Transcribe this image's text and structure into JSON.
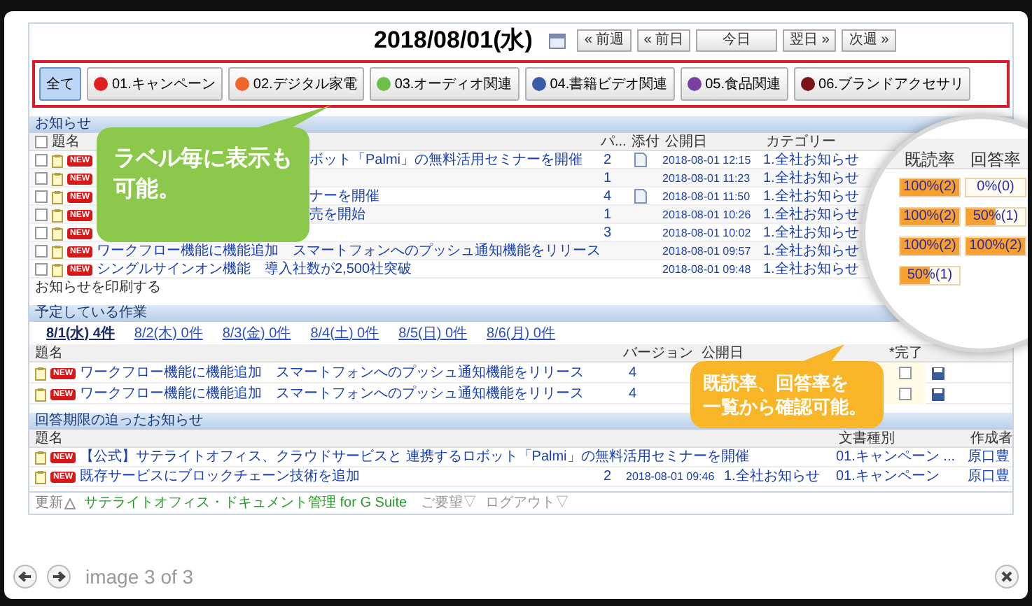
{
  "header": {
    "date": "2018/08/01(水)",
    "nav_buttons": [
      "« 前週",
      "« 前日",
      "今日",
      "翌日 »",
      "次週 »"
    ]
  },
  "labels": [
    {
      "label": "全て",
      "selected": true
    },
    {
      "label": "01.キャンペーン",
      "color": "#e02020",
      "selected": false
    },
    {
      "label": "02.デジタル家電",
      "color": "#f0642c",
      "selected": false
    },
    {
      "label": "03.オーディオ関連",
      "color": "#6cc04a",
      "selected": false
    },
    {
      "label": "04.書籍ビデオ関連",
      "color": "#3a5ba8",
      "selected": false
    },
    {
      "label": "05.食品関連",
      "color": "#7a3fa0",
      "selected": false
    },
    {
      "label": "06.ブランドアクセサリ",
      "color": "#7a1418",
      "selected": false
    }
  ],
  "notices": {
    "title": "お知らせ",
    "select_all_checked": false,
    "columns": [
      "題名",
      "パ...",
      "添付",
      "公開日",
      "カテゴリー"
    ],
    "rows": [
      {
        "kind": "covered",
        "checked": false,
        "badge": "NEW",
        "title": "ボット「Palmi」の無料活用セミナーを開催",
        "version": "2",
        "attachment": true,
        "date": "2018-08-01 12:15",
        "category": "1.全社お知らせ"
      },
      {
        "kind": "covered",
        "checked": false,
        "badge": "NEW",
        "version": "1",
        "attachment": false,
        "date": "2018-08-01 11:23",
        "category": "1.全社お知らせ"
      },
      {
        "kind": "covered",
        "checked": false,
        "badge": "NEW",
        "title": "ナーを開催",
        "version": "4",
        "attachment": true,
        "date": "2018-08-01 11:50",
        "category": "1.全社お知らせ"
      },
      {
        "kind": "covered",
        "checked": false,
        "badge": "NEW",
        "title": "売を開始",
        "version": "1",
        "attachment": false,
        "date": "2018-08-01 10:26",
        "category": "1.全社お知らせ"
      },
      {
        "kind": "covered",
        "checked": false,
        "badge": "NEW",
        "version": "3",
        "attachment": false,
        "date": "2018-08-01 10:02",
        "category": "1.全社お知らせ"
      },
      {
        "kind": "full",
        "checked": false,
        "badge": "NEW",
        "title": "ワークフロー機能に機能追加　スマートフォンへのプッシュ通知機能をリリース",
        "attachment": false,
        "date": "2018-08-01 09:57",
        "category": "1.全社お知らせ"
      },
      {
        "kind": "full",
        "checked": false,
        "badge": "NEW",
        "title": "シングルサインオン機能　導入社数が2,500社突破",
        "attachment": false,
        "date": "2018-08-01 09:48",
        "category": "1.全社お知らせ"
      }
    ],
    "print_link": "お知らせを印刷する"
  },
  "rates": {
    "columns": [
      "既読率",
      "回答率"
    ],
    "rows": [
      {
        "read": {
          "text": "100%(2)",
          "level": 1
        },
        "answer": {
          "text": "0%(0)",
          "level": 0
        }
      },
      {
        "read": {
          "text": "100%(2)",
          "level": 1
        },
        "answer": {
          "text": "50%(1)",
          "level": 0.5
        }
      },
      {
        "read": {
          "text": "100%(2)",
          "level": 1
        },
        "answer": {
          "text": "100%(2)",
          "level": 1
        }
      },
      {
        "read": {
          "text": "50%(1)",
          "level": 0.5
        }
      }
    ]
  },
  "scheduled": {
    "title": "予定している作業",
    "days": [
      {
        "label": "8/1(水) 4件",
        "selected": true
      },
      {
        "label": "8/2(木) 0件",
        "selected": false
      },
      {
        "label": "8/3(金) 0件",
        "selected": false
      },
      {
        "label": "8/4(土) 0件",
        "selected": false
      },
      {
        "label": "8/5(日) 0件",
        "selected": false
      },
      {
        "label": "8/6(月) 0件",
        "selected": false
      }
    ],
    "columns": [
      "題名",
      "バージョン",
      "公開日",
      "*完了"
    ],
    "rows": [
      {
        "badge": "NEW",
        "title": "ワークフロー機能に機能追加　スマートフォンへのプッシュ通知機能をリリース",
        "version": "4",
        "done": false
      },
      {
        "badge": "NEW",
        "title": "ワークフロー機能に機能追加　スマートフォンへのプッシュ通知機能をリリース",
        "version": "4",
        "done": false
      }
    ]
  },
  "deadline": {
    "title": "回答期限の迫ったお知らせ",
    "columns": [
      "題名",
      "文書種別",
      "作成者"
    ],
    "rows": [
      {
        "badge": "NEW",
        "title": "【公式】サテライトオフィス、クラウドサービスと 連携するロボット「Palmi」の無料活用セミナーを開催",
        "doc_type": "01.キャンペーン ...",
        "author": "原口豊"
      },
      {
        "badge": "NEW",
        "title": "既存サービスにブロックチェーン技術を追加",
        "version": "2",
        "date": "2018-08-01 09:46",
        "category": "1.全社お知らせ",
        "doc_type": "01.キャンペーン",
        "author": "原口豊"
      }
    ]
  },
  "footer": {
    "update": "更新",
    "product": "サテライトオフィス・ドキュメント管理 for G Suite",
    "links": [
      "ご要望▽",
      "ログアウト▽"
    ]
  },
  "callouts": [
    {
      "kind": "green",
      "lines": [
        "ラベル毎に表示も",
        "可能。"
      ]
    },
    {
      "kind": "orange",
      "lines": [
        "既読率、回答率を",
        "一覧から確認可能。"
      ]
    }
  ],
  "lightbox": {
    "caption": "image 3 of 3"
  }
}
